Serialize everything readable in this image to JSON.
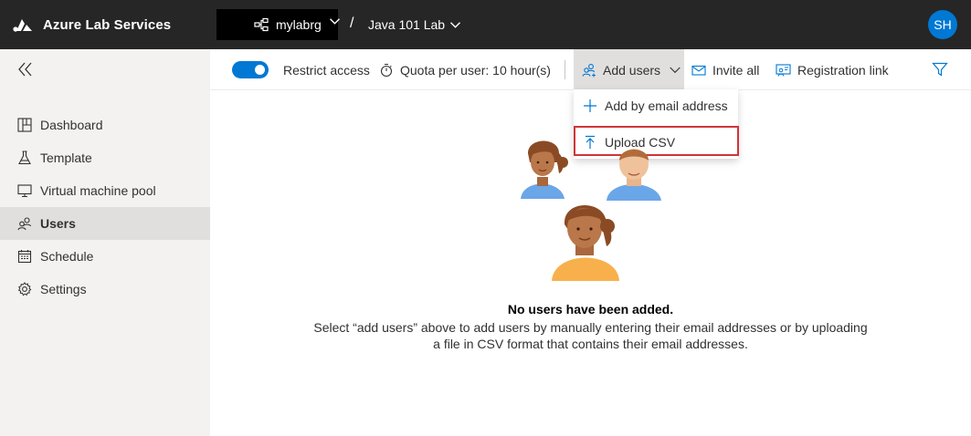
{
  "app": {
    "title": "Azure Lab Services"
  },
  "header": {
    "resource_group": "mylabrg",
    "separator": "/",
    "lab_name": "Java 101 Lab",
    "avatar_initials": "SH"
  },
  "sidebar": {
    "items": [
      {
        "label": "Dashboard",
        "icon": "dashboard-icon",
        "active": false
      },
      {
        "label": "Template",
        "icon": "flask-icon",
        "active": false
      },
      {
        "label": "Virtual machine pool",
        "icon": "monitor-icon",
        "active": false
      },
      {
        "label": "Users",
        "icon": "users-icon",
        "active": true
      },
      {
        "label": "Schedule",
        "icon": "calendar-icon",
        "active": false
      },
      {
        "label": "Settings",
        "icon": "gear-icon",
        "active": false
      }
    ]
  },
  "toolbar": {
    "restrict_access_label": "Restrict access",
    "restrict_access_on": true,
    "quota_label": "Quota per user: 10 hour(s)",
    "add_users_label": "Add users",
    "invite_all_label": "Invite all",
    "registration_link_label": "Registration link"
  },
  "add_users_menu": {
    "items": [
      {
        "label": "Add by email address",
        "icon": "plus-icon"
      },
      {
        "label": "Upload CSV",
        "icon": "upload-icon"
      }
    ]
  },
  "empty_state": {
    "title": "No users have been added.",
    "description": "Select “add users” above to add users by manually entering their email addresses or by uploading a file in CSV format that contains their email addresses."
  },
  "colors": {
    "topbar": "#262626",
    "accent": "#0078d4",
    "sidebar_bg": "#f3f2f1",
    "active_nav_bg": "#e1dfdd",
    "highlight_border": "#d13438"
  }
}
